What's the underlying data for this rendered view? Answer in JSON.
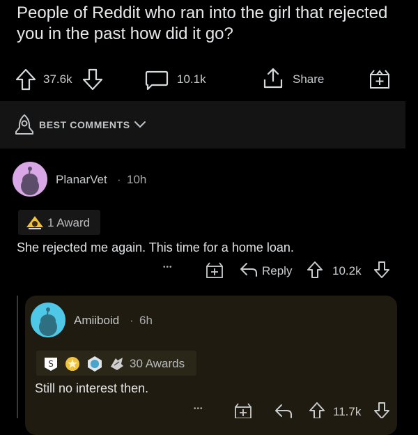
{
  "post": {
    "title": "People of Reddit who ran into the girl that rejected you in the past how did it go?",
    "upvotes": "37.6k",
    "comments": "10.1k",
    "share_label": "Share"
  },
  "sort": {
    "label": "BEST COMMENTS"
  },
  "comment1": {
    "username": "PlanarVet",
    "separator": "·",
    "age": "10h",
    "award_text": "1 Award",
    "body": "She rejected me again.  This time for a home loan.",
    "more": "•••",
    "reply_label": "Reply",
    "score": "10.2k"
  },
  "comment2": {
    "username": "Amiiboid",
    "separator": "·",
    "age": "6h",
    "award_text": "30 Awards",
    "body": "Still no interest then.",
    "more": "•••",
    "score": "11.7k"
  },
  "colors": {
    "background": "#000000",
    "sort_bar": "#141414",
    "reply_card": "#1f1b10",
    "avatar1_bg": "#d9a6e6",
    "avatar2_bg": "#4fc8e8"
  },
  "icons": [
    "upvote-icon",
    "downvote-icon",
    "comment-bubble-icon",
    "share-icon",
    "gift-icon",
    "rocket-icon",
    "chevron-down-icon",
    "award-icon",
    "reply-icon",
    "more-icon"
  ]
}
